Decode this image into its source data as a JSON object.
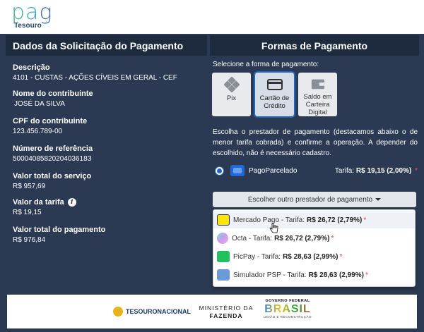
{
  "logo": {
    "brand": "pag",
    "sub": "Tesouro"
  },
  "left": {
    "title": "Dados da Solicitação do Pagamento",
    "fields": [
      {
        "label": "Descrição",
        "value": "4101 - CUSTAS - AÇÕES CÍVEIS EM GERAL - CEF"
      },
      {
        "label": "Nome do contribuinte",
        "value": "JOSÉ DA SILVA"
      },
      {
        "label": "CPF do contribuinte",
        "value": "123.456.789-00"
      },
      {
        "label": "Número de referência",
        "value": "5000408582020403618З"
      },
      {
        "label": "Valor total do serviço",
        "value": "R$ 957,69"
      },
      {
        "label": "Valor da tarifa",
        "value": "R$ 19,15",
        "icon": "info-icon"
      },
      {
        "label": "Valor total do pagamento",
        "value": "R$ 976,84"
      }
    ]
  },
  "right": {
    "title": "Formas de Pagamento",
    "select_label": "Selecione a forma de pagamento:",
    "methods": [
      {
        "label": "Pix",
        "icon": "pix-icon",
        "selected": false
      },
      {
        "label": "Cartão de Crédito",
        "icon": "credit-card-icon",
        "selected": true
      },
      {
        "label": "Saldo em Carteira Digital",
        "icon": "wallet-icon",
        "selected": false
      }
    ],
    "description": "Escolha o prestador de pagamento (destacamos abaixo o de menor tarifa cobrada) e confirme a operação. A depender do escolhido, não é necessário cadastro.",
    "selected_provider": {
      "name": "PagoParcelado",
      "tarifa_label": "Tarifa:",
      "tarifa_value": "R$ 19,15 (2,00%)",
      "star": "*"
    },
    "other_button": "Escolher outro prestador de pagamento",
    "options": [
      {
        "name": "Mercado Pago - Tarifa:",
        "value": "R$ 26,72 (2,79%)",
        "star": "*",
        "icon": "mercado-pago-icon"
      },
      {
        "name": "Octa - Tarifa:",
        "value": "R$ 26,72 (2,79%)",
        "star": "*",
        "icon": "octa-icon"
      },
      {
        "name": "PicPay - Tarifa:",
        "value": "R$ 28,63 (2,99%)",
        "star": "*",
        "icon": "picpay-icon"
      },
      {
        "name": "Simulador PSP - Tarifa:",
        "value": "R$ 28,63 (2,99%)",
        "star": "*",
        "icon": "simulator-icon"
      }
    ]
  },
  "footer": {
    "tesouro": "TESOURONACIONAL",
    "ministerio": "MINISTÉRIO DA",
    "fazenda": "FAZENDA",
    "gov": "GOVERNO FEDERAL",
    "brasil": "BRASIL",
    "uniao": "UNIÃO E RECONSTRUÇÃO"
  }
}
